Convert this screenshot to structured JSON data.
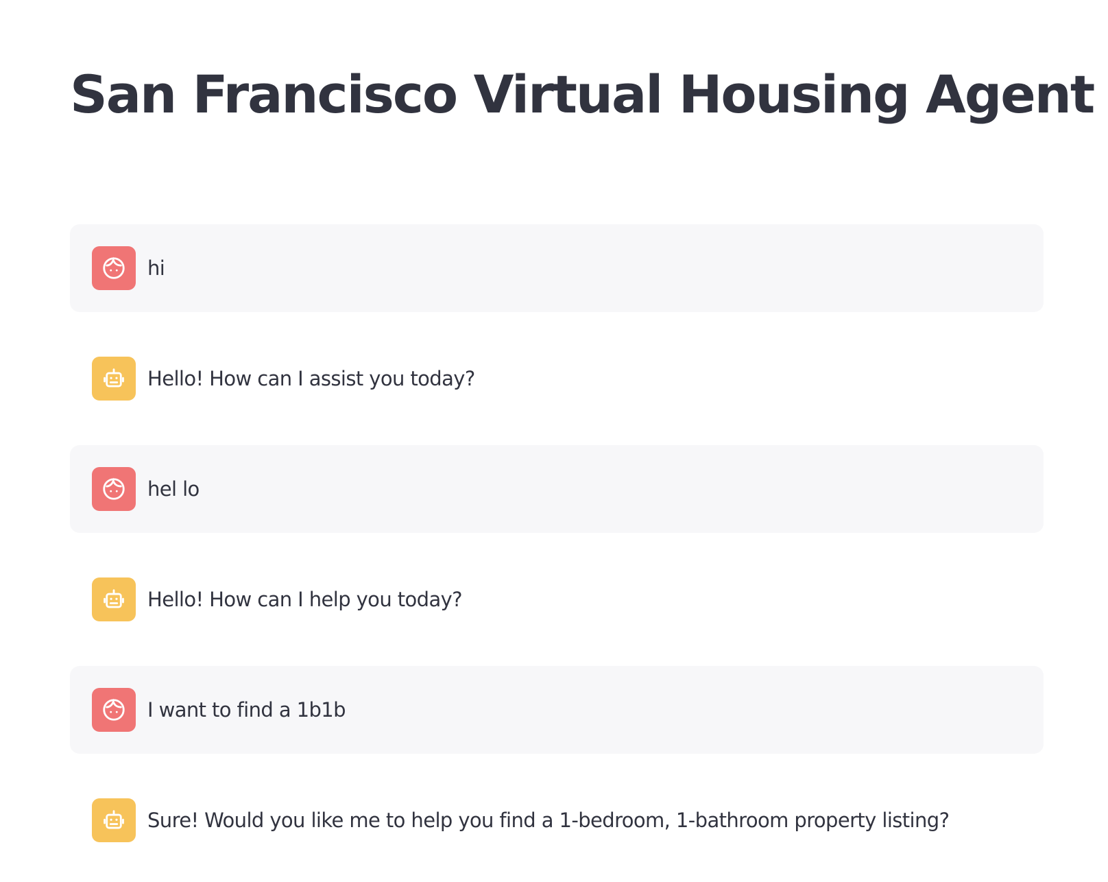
{
  "page": {
    "title": "San Francisco Virtual Housing Agent"
  },
  "colors": {
    "user_avatar": "#f07575",
    "assistant_avatar": "#f7c35a",
    "user_bubble": "#f7f7f9",
    "text": "#31333f"
  },
  "messages": [
    {
      "role": "user",
      "avatar_icon": "face-icon",
      "text": "hi"
    },
    {
      "role": "assistant",
      "avatar_icon": "robot-icon",
      "text": "Hello! How can I assist you today?"
    },
    {
      "role": "user",
      "avatar_icon": "face-icon",
      "text": "hel lo"
    },
    {
      "role": "assistant",
      "avatar_icon": "robot-icon",
      "text": "Hello! How can I help you today?"
    },
    {
      "role": "user",
      "avatar_icon": "face-icon",
      "text": "I want to find a 1b1b"
    },
    {
      "role": "assistant",
      "avatar_icon": "robot-icon",
      "text": "Sure! Would you like me to help you find a 1-bedroom, 1-bathroom property listing?"
    }
  ]
}
